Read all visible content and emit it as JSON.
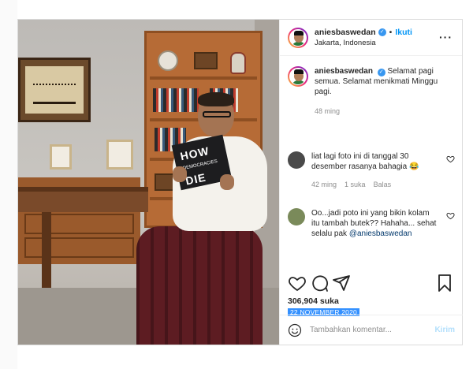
{
  "post": {
    "username": "aniesbaswedan",
    "follow_label": "Ikuti",
    "separator": "•",
    "location": "Jakarta, Indonesia",
    "more_label": "···",
    "verified_mark": "✓"
  },
  "photo": {
    "book_title_top": "HOW",
    "book_subtitle": "DEMOCRACIES",
    "book_title_bottom": "DIE"
  },
  "caption": {
    "username": "aniesbaswedan",
    "text": "Selamat pagi semua. Selamat menikmati Minggu pagi.",
    "time": "48 ming"
  },
  "comments": [
    {
      "text": "liat lagi foto ini di tanggal 30 desember rasanya bahagia 😂",
      "time": "42 ming",
      "likes": "1 suka",
      "reply": "Balas",
      "avatar_color": "#4a4a4a"
    },
    {
      "text": "Oo...jadi poto ini yang bikin kolam itu tambah butek?? Hahaha... sehat selalu pak",
      "mention": "@aniesbaswedan",
      "avatar_color": "#7a8a5a"
    }
  ],
  "stats": {
    "likes": "306,904 suka",
    "date": "22 NOVEMBER 2020"
  },
  "composer": {
    "placeholder": "Tambahkan komentar...",
    "post_label": "Kirim"
  },
  "icons": {
    "like": "heart-icon",
    "comment": "comment-icon",
    "share": "share-icon",
    "save": "bookmark-icon",
    "emoji": "emoji-icon"
  },
  "colors": {
    "link_blue": "#0095f6",
    "muted": "#8e8e8e",
    "date_highlight": "#3390ff"
  }
}
